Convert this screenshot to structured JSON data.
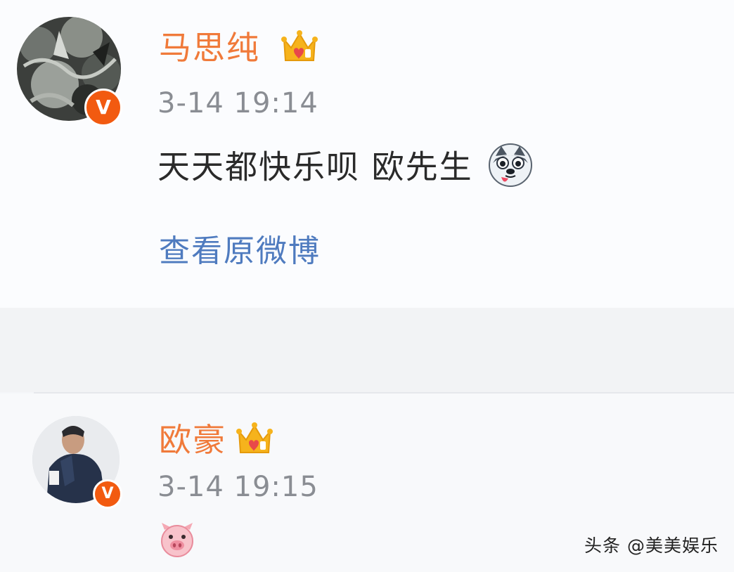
{
  "comments": [
    {
      "author": "马思纯",
      "timestamp": "3-14 19:14",
      "text": "天天都快乐呗 欧先生",
      "text_emoji": "husky-emoji",
      "link_label": "查看原微博",
      "verified_badge": "V",
      "member_icon": "crown-icon"
    },
    {
      "author": "欧豪",
      "timestamp": "3-14 19:15",
      "text_emoji": "pig-emoji",
      "verified_badge": "V",
      "member_icon": "crown-icon"
    }
  ],
  "watermark": "头条 @美美娱乐",
  "colors": {
    "name": "#f07a3a",
    "link": "#4f7bbf",
    "badge": "#f25a10",
    "timestamp": "#8a8d93"
  }
}
